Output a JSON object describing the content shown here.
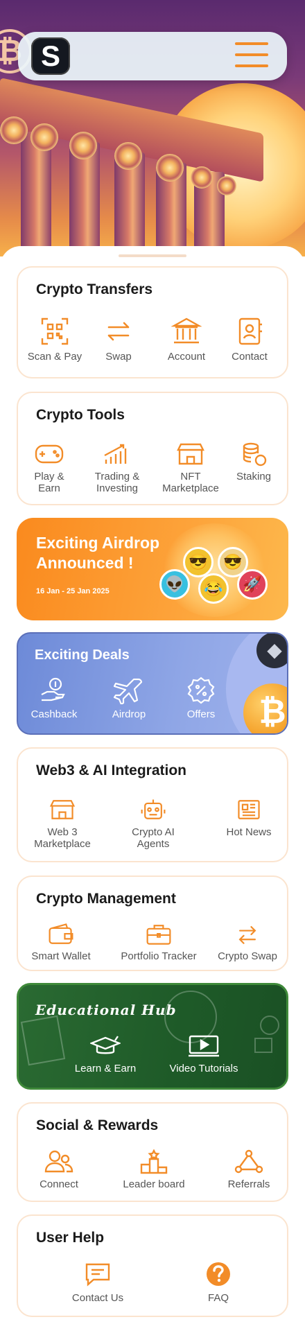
{
  "header": {
    "logo_letter": "S"
  },
  "crypto_transfers": {
    "title": "Crypto Transfers",
    "items": [
      "Scan & Pay",
      "Swap",
      "Account",
      "Contact"
    ]
  },
  "crypto_tools": {
    "title": "Crypto Tools",
    "items": [
      "Play &\nEarn",
      "Trading &\nInvesting",
      "NFT\nMarketplace",
      "Staking"
    ]
  },
  "airdrop": {
    "title": "Exciting Airdrop Announced !",
    "date": "16 Jan - 25 Jan 2025"
  },
  "deals": {
    "title": "Exciting Deals",
    "items": [
      "Cashback",
      "Airdrop",
      "Offers"
    ]
  },
  "web3": {
    "title": "Web3 & AI Integration",
    "items": [
      "Web 3\nMarketplace",
      "Crypto AI\nAgents",
      "Hot News"
    ]
  },
  "management": {
    "title": "Crypto Management",
    "items": [
      "Smart Wallet",
      "Portfolio Tracker",
      "Crypto Swap"
    ]
  },
  "edu": {
    "title": "Educational Hub",
    "items": [
      "Learn & Earn",
      "Video Tutorials"
    ]
  },
  "social": {
    "title": "Social & Rewards",
    "items": [
      "Connect",
      "Leader board",
      "Referrals"
    ]
  },
  "help": {
    "title": "User Help",
    "items": [
      "Contact Us",
      "FAQ"
    ]
  },
  "colors": {
    "accent": "#f28c28",
    "card_border": "#fbe4cf",
    "deals_bg": "#7a93de",
    "edu_bg": "#22602c"
  }
}
